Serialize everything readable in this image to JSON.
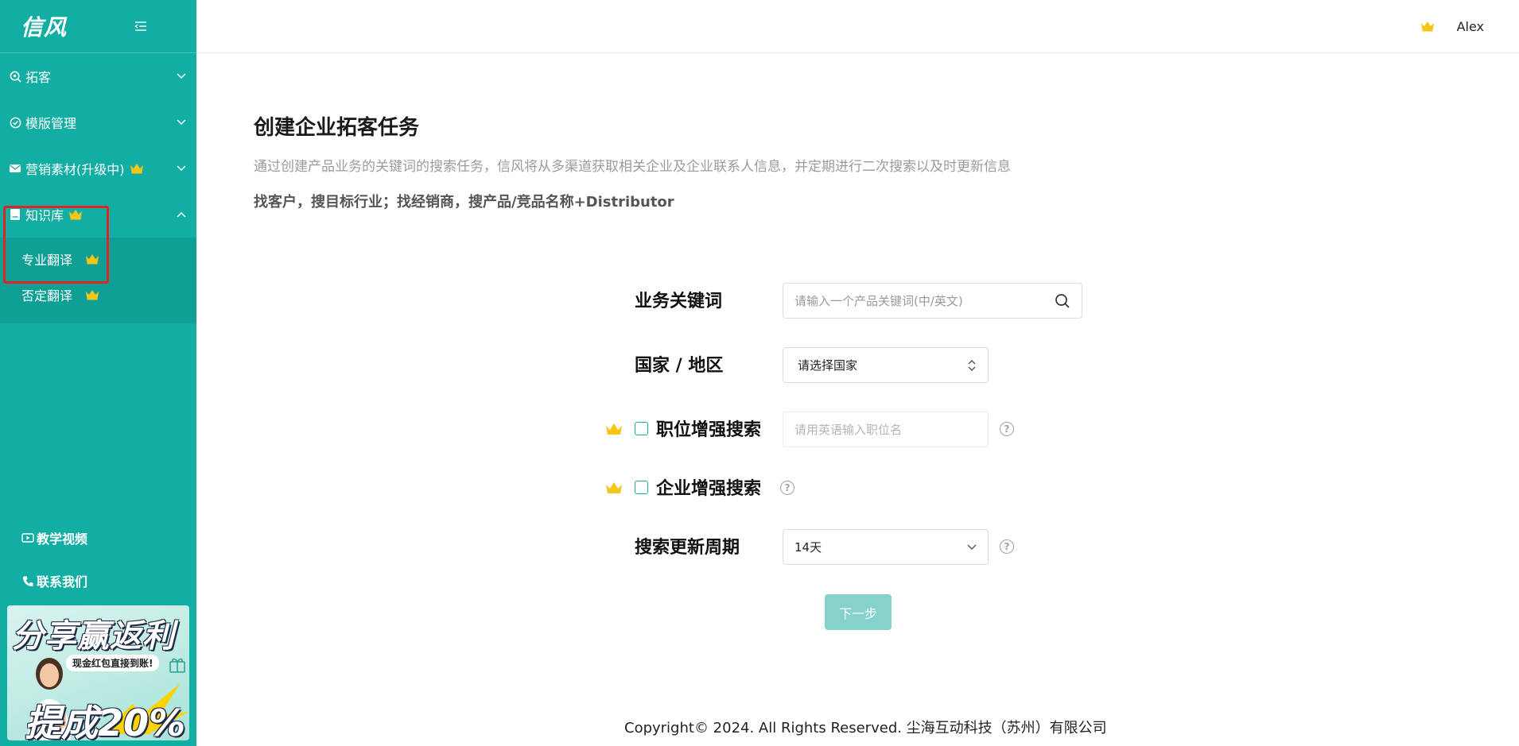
{
  "app": {
    "logo": "信风"
  },
  "sidebar": {
    "items": [
      {
        "label": "拓客",
        "icon": "search-target-icon",
        "expanded": false
      },
      {
        "label": "模版管理",
        "icon": "check-circle-icon",
        "expanded": false
      },
      {
        "label": "营销素材(升级中)",
        "icon": "mail-icon",
        "expanded": false,
        "premium": true
      },
      {
        "label": "知识库",
        "icon": "book-icon",
        "expanded": true,
        "premium": true,
        "children": [
          {
            "label": "专业翻译",
            "premium": true
          },
          {
            "label": "否定翻译",
            "premium": true
          }
        ]
      }
    ],
    "bottom": [
      {
        "label": "教学视频",
        "icon": "video-icon"
      },
      {
        "label": "联系我们",
        "icon": "phone-icon"
      }
    ],
    "promo": {
      "title": "分享赢返利",
      "subtitle": "现金红包直接到账!",
      "big": "提成20%"
    }
  },
  "header": {
    "user_name": "Alex"
  },
  "page": {
    "title": "创建企业拓客任务",
    "description": "通过创建产品业务的关键词的搜索任务，信风将从多渠道获取相关企业及企业联系人信息，并定期进行二次搜索以及时更新信息",
    "tip": "找客户，搜目标行业；找经销商，搜产品/竞品名称+Distributor"
  },
  "form": {
    "keyword": {
      "label": "业务关键词",
      "placeholder": "请输入一个产品关键词(中/英文)"
    },
    "country": {
      "label": "国家 / 地区",
      "value": "请选择国家"
    },
    "position": {
      "label": "职位增强搜索",
      "placeholder": "请用英语输入职位名",
      "checked": false
    },
    "company": {
      "label": "企业增强搜索",
      "checked": false
    },
    "period": {
      "label": "搜索更新周期",
      "value": "14天"
    },
    "next_label": "下一步"
  },
  "footer": {
    "copyright": "Copyright© 2024. All Rights Reserved. 尘海互动科技（苏州）有限公司"
  },
  "colors": {
    "primary": "#13aea3",
    "crown": "#f5c518",
    "highlight": "#e02424"
  }
}
